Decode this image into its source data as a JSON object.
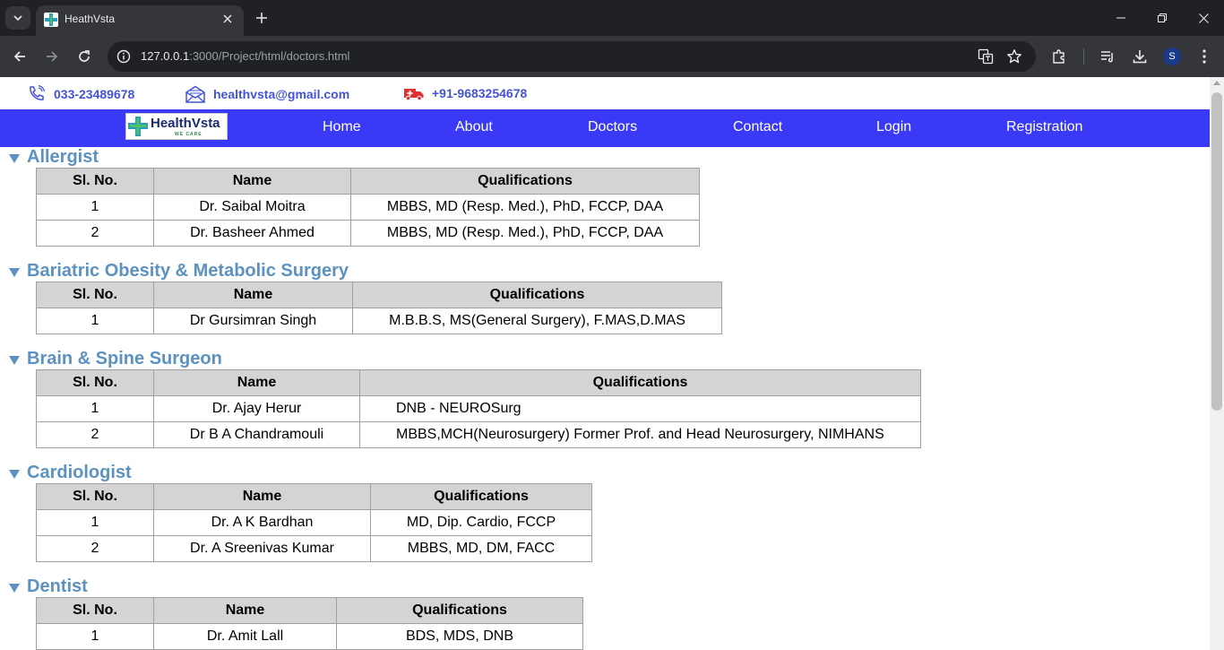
{
  "browser": {
    "tab_title": "HeathVsta",
    "url_host": "127.0.0.1",
    "url_rest": ":3000/Project/html/doctors.html",
    "profile_initial": "S"
  },
  "contact": {
    "phone": "033-23489678",
    "email": "healthvsta@gmail.com",
    "ambulance": "+91-9683254678"
  },
  "nav": {
    "logo_text": "HealthVsta",
    "logo_tagline": "WE CARE",
    "links": [
      "Home",
      "About",
      "Doctors",
      "Contact",
      "Login",
      "Registration"
    ]
  },
  "table_headers": {
    "sl_no": "Sl. No.",
    "name": "Name",
    "qualifications": "Qualifications"
  },
  "sections": [
    {
      "title": "Allergist",
      "rows": [
        {
          "sl": "1",
          "name": "Dr. Saibal Moitra",
          "qual": "MBBS, MD (Resp. Med.), PhD, FCCP, DAA"
        },
        {
          "sl": "2",
          "name": "Dr. Basheer Ahmed",
          "qual": "MBBS, MD (Resp. Med.), PhD, FCCP, DAA"
        }
      ]
    },
    {
      "title": "Bariatric Obesity & Metabolic Surgery",
      "rows": [
        {
          "sl": "1",
          "name": "Dr Gursimran Singh",
          "qual": "M.B.B.S, MS(General Surgery), F.MAS,D.MAS"
        }
      ]
    },
    {
      "title": "Brain & Spine Surgeon",
      "rows": [
        {
          "sl": "1",
          "name": "Dr. Ajay Herur",
          "qual": "DNB - NEUROSurg"
        },
        {
          "sl": "2",
          "name": "Dr B A Chandramouli",
          "qual": "MBBS,MCH(Neurosurgery) Former Prof. and Head Neurosurgery, NIMHANS"
        }
      ]
    },
    {
      "title": "Cardiologist",
      "rows": [
        {
          "sl": "1",
          "name": "Dr. A K Bardhan",
          "qual": "MD, Dip. Cardio, FCCP"
        },
        {
          "sl": "2",
          "name": "Dr. A Sreenivas Kumar",
          "qual": "MBBS, MD, DM, FACC"
        }
      ]
    },
    {
      "title": "Dentist",
      "rows": [
        {
          "sl": "1",
          "name": "Dr. Amit Lall",
          "qual": "BDS, MDS, DNB"
        }
      ]
    }
  ]
}
